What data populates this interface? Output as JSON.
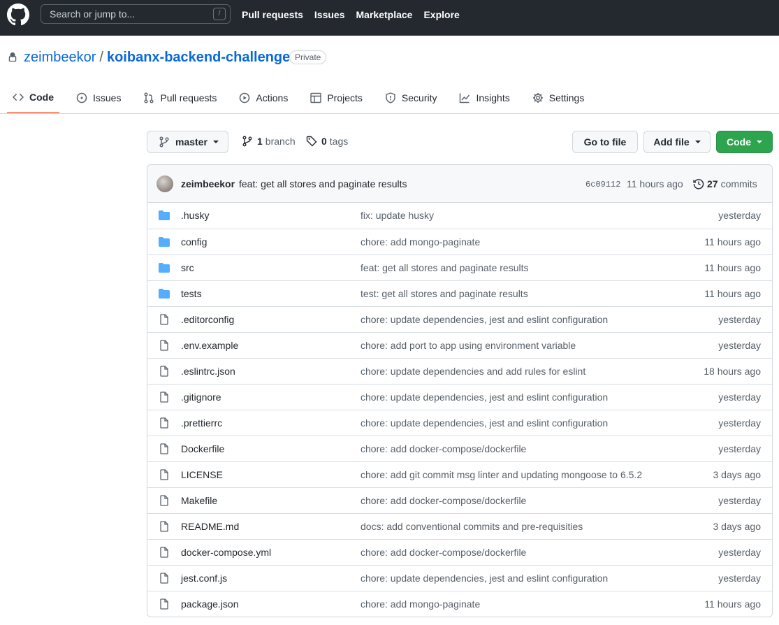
{
  "header": {
    "search_placeholder": "Search or jump to...",
    "search_key": "/",
    "nav": [
      "Pull requests",
      "Issues",
      "Marketplace",
      "Explore"
    ]
  },
  "repo": {
    "owner": "zeimbeekor",
    "separator": "/",
    "name": "koibanx-backend-challenge",
    "visibility": "Private"
  },
  "tabs": [
    {
      "label": "Code",
      "icon": "code-icon",
      "selected": true
    },
    {
      "label": "Issues",
      "icon": "issue-opened-icon"
    },
    {
      "label": "Pull requests",
      "icon": "git-pull-request-icon"
    },
    {
      "label": "Actions",
      "icon": "play-icon"
    },
    {
      "label": "Projects",
      "icon": "table-icon"
    },
    {
      "label": "Security",
      "icon": "shield-icon"
    },
    {
      "label": "Insights",
      "icon": "graph-icon"
    },
    {
      "label": "Settings",
      "icon": "gear-icon"
    }
  ],
  "branch": {
    "current": "master",
    "branch_count": "1",
    "branch_label": "branch",
    "tag_count": "0",
    "tag_label": "tags"
  },
  "actions": {
    "go_to_file": "Go to file",
    "add_file": "Add file",
    "code": "Code"
  },
  "commit": {
    "author": "zeimbeekor",
    "message": "feat: get all stores and paginate results",
    "sha": "6c09112",
    "time": "11 hours ago",
    "count": "27",
    "count_label": "commits"
  },
  "files": [
    {
      "type": "dir",
      "name": ".husky",
      "message": "fix: update husky",
      "age": "yesterday"
    },
    {
      "type": "dir",
      "name": "config",
      "message": "chore: add mongo-paginate",
      "age": "11 hours ago"
    },
    {
      "type": "dir",
      "name": "src",
      "message": "feat: get all stores and paginate results",
      "age": "11 hours ago"
    },
    {
      "type": "dir",
      "name": "tests",
      "message": "test: get all stores and paginate results",
      "age": "11 hours ago"
    },
    {
      "type": "file",
      "name": ".editorconfig",
      "message": "chore: update dependencies, jest and eslint configuration",
      "age": "yesterday"
    },
    {
      "type": "file",
      "name": ".env.example",
      "message": "chore: add port to app using environment variable",
      "age": "yesterday"
    },
    {
      "type": "file",
      "name": ".eslintrc.json",
      "message": "chore: update dependencies and add rules for eslint",
      "age": "18 hours ago"
    },
    {
      "type": "file",
      "name": ".gitignore",
      "message": "chore: update dependencies, jest and eslint configuration",
      "age": "yesterday"
    },
    {
      "type": "file",
      "name": ".prettierrc",
      "message": "chore: update dependencies, jest and eslint configuration",
      "age": "yesterday"
    },
    {
      "type": "file",
      "name": "Dockerfile",
      "message": "chore: add docker-compose/dockerfile",
      "age": "yesterday"
    },
    {
      "type": "file",
      "name": "LICENSE",
      "message": "chore: add git commit msg linter and updating mongoose to 6.5.2",
      "age": "3 days ago"
    },
    {
      "type": "file",
      "name": "Makefile",
      "message": "chore: add docker-compose/dockerfile",
      "age": "yesterday"
    },
    {
      "type": "file",
      "name": "README.md",
      "message": "docs: add conventional commits and pre-requisities",
      "age": "3 days ago"
    },
    {
      "type": "file",
      "name": "docker-compose.yml",
      "message": "chore: add docker-compose/dockerfile",
      "age": "yesterday"
    },
    {
      "type": "file",
      "name": "jest.conf.js",
      "message": "chore: update dependencies, jest and eslint configuration",
      "age": "yesterday"
    },
    {
      "type": "file",
      "name": "package.json",
      "message": "chore: add mongo-paginate",
      "age": "11 hours ago"
    }
  ],
  "colors": {
    "header_bg": "#24292f",
    "link": "#0969da",
    "folder": "#54aeff",
    "tab_underline": "#fd8c73",
    "primary_button": "#2da44e"
  }
}
